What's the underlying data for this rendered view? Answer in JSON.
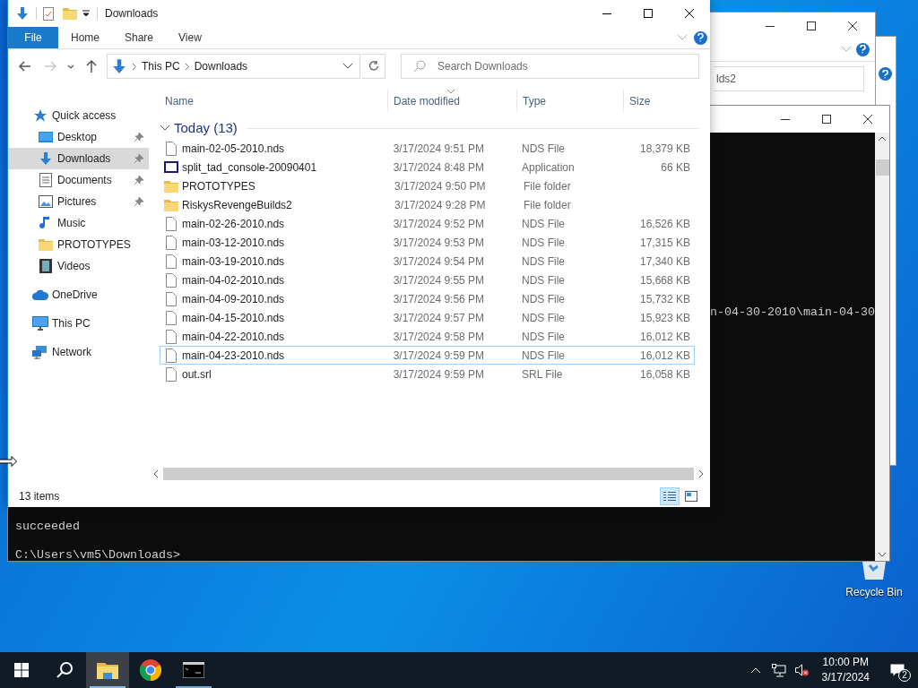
{
  "back_windows": [
    {
      "kind": "explorer",
      "address": "lds2"
    },
    {
      "kind": "dialog"
    }
  ],
  "console": {
    "lines": [
      {
        "text": "n-04-30-2010\\main-04-30",
        "kind": "partial"
      },
      {
        "text": "succeeded",
        "kind": "full"
      },
      {
        "text": "C:\\Users\\vm5\\Downloads>",
        "kind": "full"
      }
    ]
  },
  "explorer": {
    "title": "Downloads",
    "ribbon_tabs": [
      {
        "label": "File",
        "kind": "file"
      },
      {
        "label": "Home",
        "kind": "tab"
      },
      {
        "label": "Share",
        "kind": "tab"
      },
      {
        "label": "View",
        "kind": "tab"
      }
    ],
    "nav_buttons": [
      {
        "kind": "back",
        "disabled": false
      },
      {
        "kind": "forward",
        "disabled": true
      },
      {
        "kind": "recent",
        "disabled": false
      },
      {
        "kind": "up",
        "disabled": false
      }
    ],
    "breadcrumb": [
      "This PC",
      "Downloads"
    ],
    "search": {
      "placeholder": "Search Downloads"
    },
    "nav_pane": [
      {
        "label": "Quick access",
        "kind": "star",
        "selected": false,
        "children": [
          {
            "label": "Desktop",
            "kind": "desktop",
            "pinned": true,
            "selected": false
          },
          {
            "label": "Downloads",
            "kind": "download",
            "pinned": true,
            "selected": true
          },
          {
            "label": "Documents",
            "kind": "documents",
            "pinned": true,
            "selected": false
          },
          {
            "label": "Pictures",
            "kind": "pictures",
            "pinned": true,
            "selected": false
          },
          {
            "label": "Music",
            "kind": "music",
            "pinned": false,
            "selected": false
          },
          {
            "label": "PROTOTYPES",
            "kind": "folder",
            "pinned": false,
            "selected": false
          },
          {
            "label": "Videos",
            "kind": "videos",
            "pinned": false,
            "selected": false
          }
        ]
      },
      {
        "label": "OneDrive",
        "kind": "cloud",
        "selected": false
      },
      {
        "label": "This PC",
        "kind": "pc",
        "selected": false
      },
      {
        "label": "Network",
        "kind": "network",
        "selected": false
      }
    ],
    "columns": [
      {
        "label": "Name",
        "sorted": false
      },
      {
        "label": "Date modified",
        "sorted": true
      },
      {
        "label": "Type",
        "sorted": false
      },
      {
        "label": "Size",
        "sorted": false
      }
    ],
    "group": {
      "label": "Today (13)",
      "expanded": true
    },
    "files": [
      {
        "name": "main-02-05-2010.nds",
        "date": "3/17/2024 9:51 PM",
        "type": "NDS File",
        "size": "18,379 KB",
        "kind": "file",
        "focused": false
      },
      {
        "name": "split_tad_console-20090401",
        "date": "3/17/2024 8:48 PM",
        "type": "Application",
        "size": "66 KB",
        "kind": "app",
        "focused": false
      },
      {
        "name": "PROTOTYPES",
        "date": "3/17/2024 9:50 PM",
        "type": "File folder",
        "kind": "folder",
        "focused": false
      },
      {
        "name": "RiskysRevengeBuilds2",
        "date": "3/17/2024 9:28 PM",
        "type": "File folder",
        "kind": "folder",
        "focused": false
      },
      {
        "name": "main-02-26-2010.nds",
        "date": "3/17/2024 9:52 PM",
        "type": "NDS File",
        "size": "16,526 KB",
        "kind": "file",
        "focused": false
      },
      {
        "name": "main-03-12-2010.nds",
        "date": "3/17/2024 9:53 PM",
        "type": "NDS File",
        "size": "17,315 KB",
        "kind": "file",
        "focused": false
      },
      {
        "name": "main-03-19-2010.nds",
        "date": "3/17/2024 9:54 PM",
        "type": "NDS File",
        "size": "17,340 KB",
        "kind": "file",
        "focused": false
      },
      {
        "name": "main-04-02-2010.nds",
        "date": "3/17/2024 9:55 PM",
        "type": "NDS File",
        "size": "15,668 KB",
        "kind": "file",
        "focused": false
      },
      {
        "name": "main-04-09-2010.nds",
        "date": "3/17/2024 9:56 PM",
        "type": "NDS File",
        "size": "15,732 KB",
        "kind": "file",
        "focused": false
      },
      {
        "name": "main-04-15-2010.nds",
        "date": "3/17/2024 9:57 PM",
        "type": "NDS File",
        "size": "15,923 KB",
        "kind": "file",
        "focused": false
      },
      {
        "name": "main-04-22-2010.nds",
        "date": "3/17/2024 9:58 PM",
        "type": "NDS File",
        "size": "16,012 KB",
        "kind": "file",
        "focused": false
      },
      {
        "name": "main-04-23-2010.nds",
        "date": "3/17/2024 9:59 PM",
        "type": "NDS File",
        "size": "16,012 KB",
        "kind": "file",
        "focused": true
      },
      {
        "name": "out.srl",
        "date": "3/17/2024 9:59 PM",
        "type": "SRL File",
        "size": "16,058 KB",
        "kind": "file",
        "focused": false
      }
    ],
    "status": "13 items",
    "views": [
      {
        "kind": "details",
        "selected": true
      },
      {
        "kind": "tiles",
        "selected": false
      }
    ]
  },
  "desktop_icons": [
    {
      "label": "Recycle Bin"
    }
  ],
  "taskbar": {
    "apps": [
      {
        "kind": "start",
        "running": false,
        "active": false
      },
      {
        "kind": "search",
        "running": false,
        "active": false
      },
      {
        "kind": "explorer",
        "running": true,
        "active": true
      },
      {
        "kind": "chrome",
        "running": false,
        "active": false
      },
      {
        "kind": "console",
        "running": true,
        "active": false
      }
    ],
    "tray": {
      "time": "10:00 PM",
      "date": "3/17/2024",
      "notifications": "2",
      "muted": true
    }
  }
}
